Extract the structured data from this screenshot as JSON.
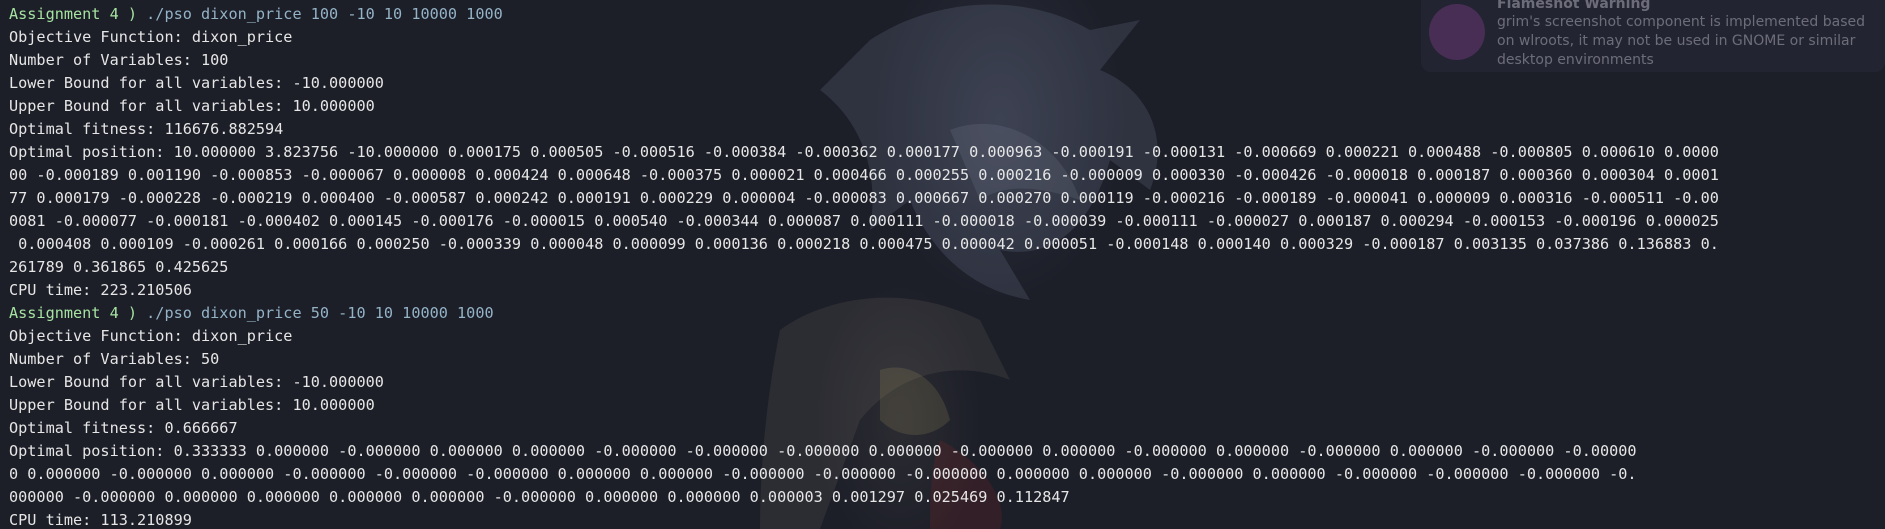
{
  "toast": {
    "title": "Flameshot Warning",
    "body": "grim's screenshot component is implemented based on wlroots, it may not be used in GNOME or similar desktop environments",
    "icon": "flameshot-icon"
  },
  "run1": {
    "prompt_dir": "Assignment 4 ) ",
    "command": "./pso dixon_price 100 -10 10 10000 1000",
    "objective": "Objective Function: dixon_price",
    "num_vars": "Number of Variables: 100",
    "lower": "Lower Bound for all variables: -10.000000",
    "upper": "Upper Bound for all variables: 10.000000",
    "fitness": "Optimal fitness: 116676.882594",
    "position_lines": [
      "Optimal position: 10.000000 3.823756 -10.000000 0.000175 0.000505 -0.000516 -0.000384 -0.000362 0.000177 0.000963 -0.000191 -0.000131 -0.000669 0.000221 0.000488 -0.000805 0.000610 0.0000",
      "00 -0.000189 0.001190 -0.000853 -0.000067 0.000008 0.000424 0.000648 -0.000375 0.000021 0.000466 0.000255 0.000216 -0.000009 0.000330 -0.000426 -0.000018 0.000187 0.000360 0.000304 0.0001",
      "77 0.000179 -0.000228 -0.000219 0.000400 -0.000587 0.000242 0.000191 0.000229 0.000004 -0.000083 0.000667 0.000270 0.000119 -0.000216 -0.000189 -0.000041 0.000009 0.000316 -0.000511 -0.00",
      "0081 -0.000077 -0.000181 -0.000402 0.000145 -0.000176 -0.000015 0.000540 -0.000344 0.000087 0.000111 -0.000018 -0.000039 -0.000111 -0.000027 0.000187 0.000294 -0.000153 -0.000196 0.000025",
      " 0.000408 0.000109 -0.000261 0.000166 0.000250 -0.000339 0.000048 0.000099 0.000136 0.000218 0.000475 0.000042 0.000051 -0.000148 0.000140 0.000329 -0.000187 0.003135 0.037386 0.136883 0.",
      "261789 0.361865 0.425625"
    ],
    "cpu": "CPU time: 223.210506"
  },
  "run2": {
    "prompt_dir": "Assignment 4 ) ",
    "command": "./pso dixon_price 50 -10 10 10000 1000",
    "objective": "Objective Function: dixon_price",
    "num_vars": "Number of Variables: 50",
    "lower": "Lower Bound for all variables: -10.000000",
    "upper": "Upper Bound for all variables: 10.000000",
    "fitness": "Optimal fitness: 0.666667",
    "position_lines": [
      "Optimal position: 0.333333 0.000000 -0.000000 0.000000 0.000000 -0.000000 -0.000000 -0.000000 0.000000 -0.000000 0.000000 -0.000000 0.000000 -0.000000 0.000000 -0.000000 -0.00000",
      "0 0.000000 -0.000000 0.000000 -0.000000 -0.000000 -0.000000 0.000000 0.000000 -0.000000 -0.000000 -0.000000 0.000000 0.000000 -0.000000 0.000000 -0.000000 -0.000000 -0.000000 -0.",
      "000000 -0.000000 0.000000 0.000000 0.000000 0.000000 -0.000000 0.000000 0.000000 0.000003 0.001297 0.025469 0.112847"
    ],
    "cpu": "CPU time: 113.210899"
  },
  "colors": {
    "background": "#1c1e28",
    "foreground": "#e6e6e6",
    "prompt_dir": "#a6e3a1",
    "prompt_cmd": "#94b3c7"
  }
}
